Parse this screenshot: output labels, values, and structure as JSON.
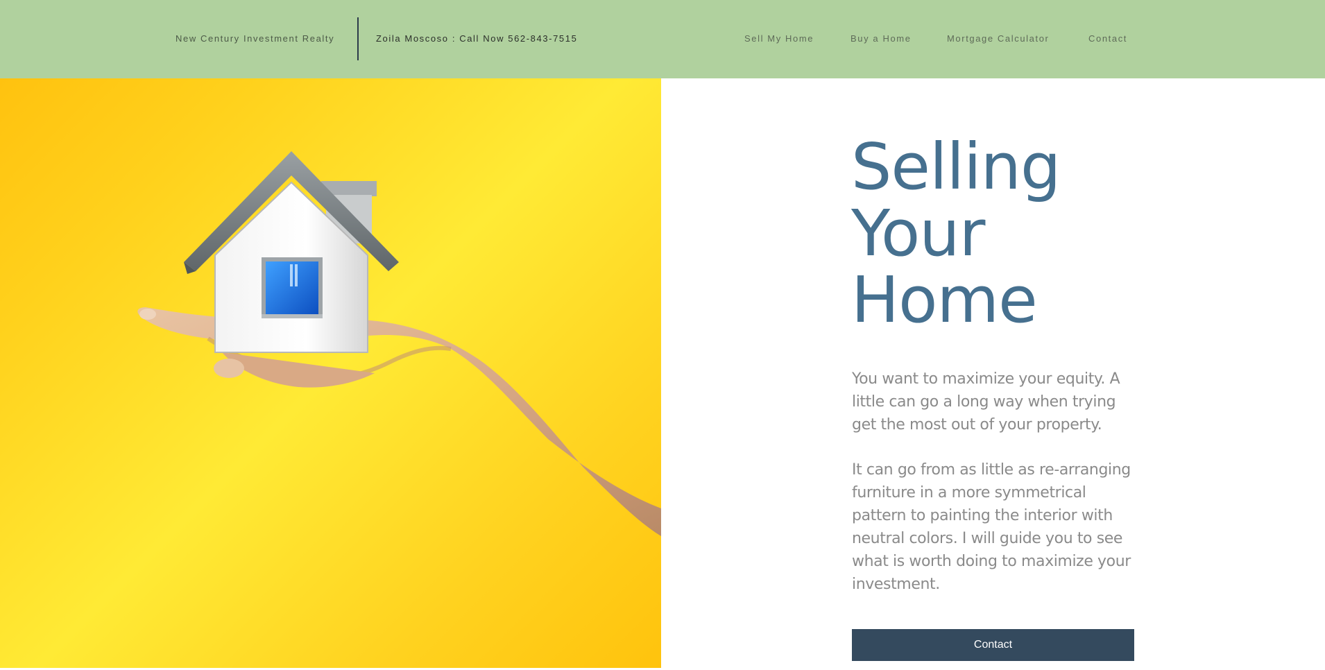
{
  "header": {
    "brand": "New Century Investment Realty",
    "agent": "Zoila Moscoso : Call Now 562-843-7515",
    "nav": [
      {
        "label": "Sell My Home"
      },
      {
        "label": "Buy a Home"
      },
      {
        "label": "Mortgage Calculator"
      },
      {
        "label": "Contact"
      }
    ]
  },
  "hero": {
    "image_icon": "house-in-hand-image",
    "background_colors": [
      "#ffc20f",
      "#ffea35"
    ],
    "title": "Selling Your Home",
    "paragraph1": "You want to maximize your equity. A little can go a long way when trying get the most out of your property.",
    "paragraph2": "It can go from as little as re-arranging furniture in a more symmetrical pattern to painting the interior with neutral colors. I will guide you to see what is worth doing to maximize your investment.",
    "cta_label": "Contact"
  },
  "colors": {
    "header_bg": "#b0d19e",
    "title": "#46708f",
    "button_bg": "#344a5e"
  }
}
